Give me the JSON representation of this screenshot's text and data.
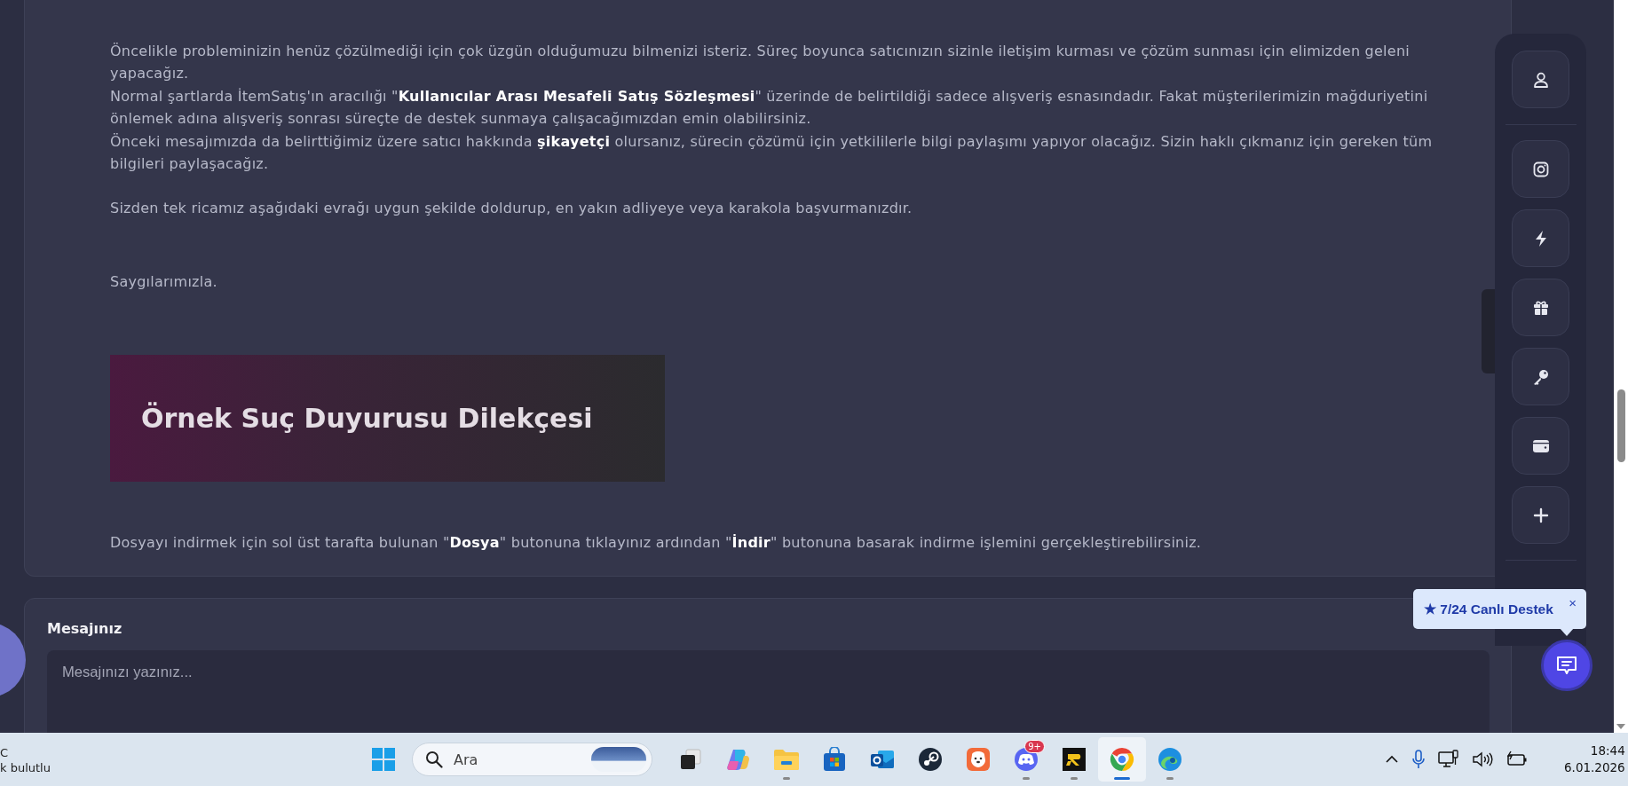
{
  "message": {
    "paragraphs": [
      "Öncelikle probleminizin henüz çözülmediği için çok üzgün olduğumuzu bilmenizi isteriz. Süreç boyunca satıcınızın sizinle iletişim kurması ve çözüm sunması için elimizden geleni yapacağız.",
      "Normal şartlarda İtemSatış'ın aracılığı \"**Kullanıcılar Arası Mesafeli Satış Sözleşmesi**\" üzerinde de belirtildiği sadece alışveriş esnasındadır. Fakat müşterilerimizin mağduriyetini önlemek adına alışveriş sonrası süreçte de destek sunmaya çalışacağımızdan emin olabilirsiniz.",
      "Önceki mesajımızda da belirttiğimiz üzere satıcı hakkında **şikayetçi** olursanız, sürecin çözümü için yetkililerle bilgi paylaşımı yapıyor olacağız. Sizin haklı çıkmanız için gereken tüm bilgileri paylaşacağız."
    ],
    "request": "Sizden tek ricamız aşağıdaki evrağı uygun şekilde doldurup, en yakın adliyeye veya karakola başvurmanızdır.",
    "closing": "Saygılarımızla.",
    "banner_title": "Örnek Suç Duyurusu Dilekçesi",
    "download_note": "Dosyayı indirmek için sol üst tarafta bulunan \"**Dosya**\" butonuna tıklayınız ardından \"**İndir**\" butonuna basarak indirme işlemini gerçekleştirebilirsiniz."
  },
  "reply": {
    "label": "Mesajınız",
    "placeholder": "Mesajınızı yazınız..."
  },
  "sidebar": {
    "buttons": [
      {
        "kind": "user"
      },
      {
        "kind": "instagram"
      },
      {
        "kind": "bolt"
      },
      {
        "kind": "gift"
      },
      {
        "kind": "key"
      },
      {
        "kind": "wallet"
      },
      {
        "kind": "plus"
      }
    ]
  },
  "support_tooltip": {
    "text": "★ 7/24 Canlı Destek",
    "close": "×"
  },
  "taskbar": {
    "weather": [
      "C",
      "k bulutlu"
    ],
    "search_placeholder": "Ara",
    "apps": [
      {
        "kind": "task-view",
        "running": false,
        "selected": false
      },
      {
        "kind": "copilot",
        "running": false,
        "selected": false
      },
      {
        "kind": "folder",
        "running": true,
        "selected": false
      },
      {
        "kind": "store",
        "running": false,
        "selected": false
      },
      {
        "kind": "mail",
        "running": false,
        "selected": false
      },
      {
        "kind": "steam",
        "running": false,
        "selected": false
      },
      {
        "kind": "dog",
        "running": false,
        "selected": false
      },
      {
        "kind": "chat",
        "badge": "9+",
        "running": true,
        "selected": false
      },
      {
        "kind": "r-logo",
        "running": true,
        "selected": false
      },
      {
        "kind": "chrome",
        "running": true,
        "selected": true
      },
      {
        "kind": "edge",
        "running": true,
        "selected": false
      }
    ],
    "time": "18:44",
    "date": "6.01.2026"
  }
}
